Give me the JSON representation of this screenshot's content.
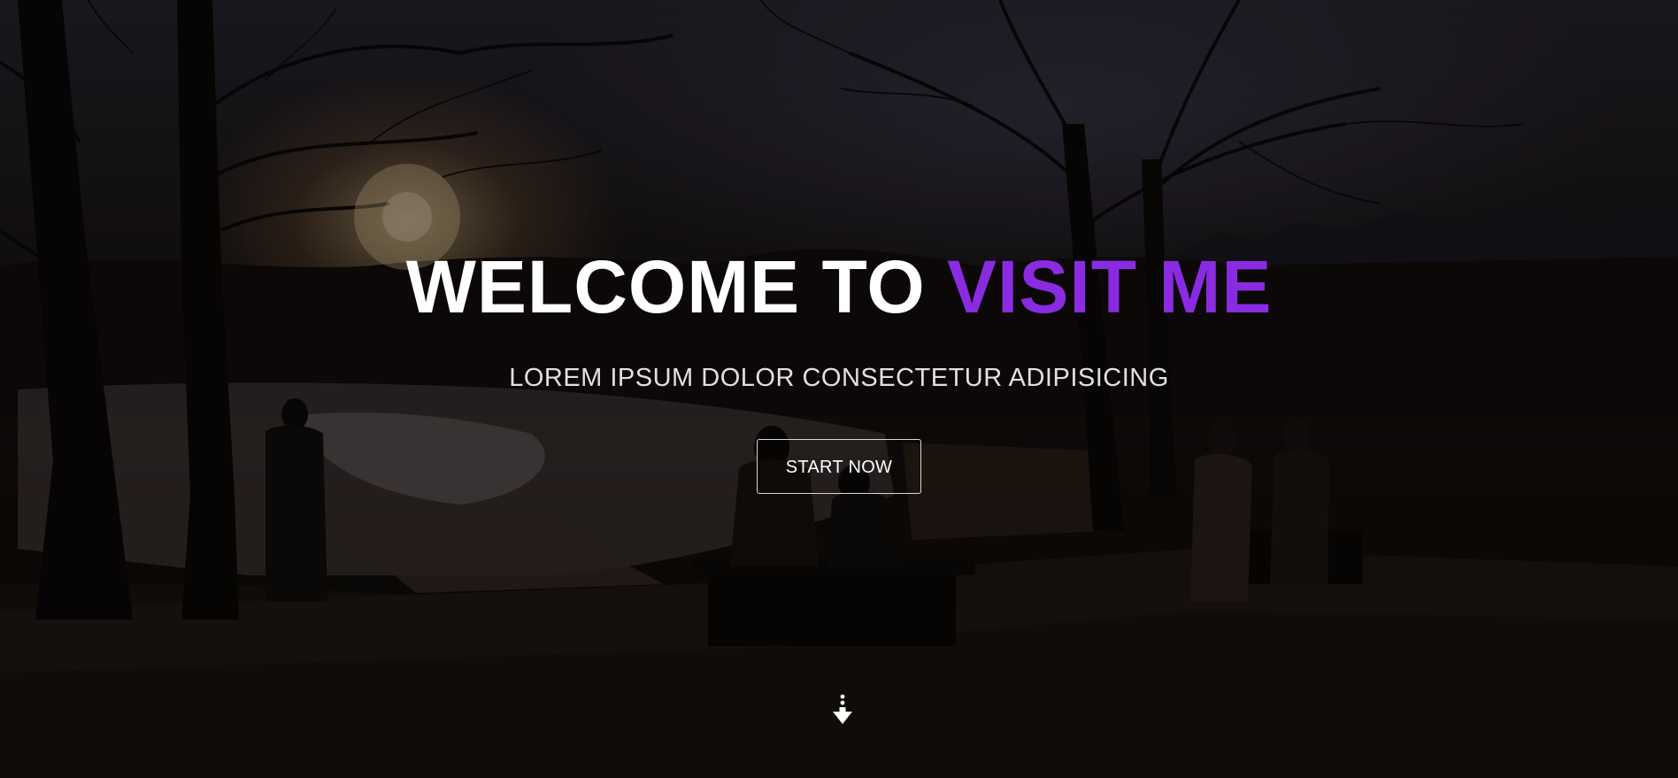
{
  "hero": {
    "headline_part1": "WELCOME TO ",
    "headline_part2": "VISIT ME",
    "subtitle": "LOREM IPSUM DOLOR CONSECTETUR ADIPISICING",
    "cta_label": "START NOW"
  },
  "icons": {
    "scroll": "arrow-down-icon"
  },
  "colors": {
    "accent": "#8a2be2",
    "headline": "#ffffff",
    "subtitle": "#e2dfe4",
    "button_border": "#d8d6da"
  }
}
